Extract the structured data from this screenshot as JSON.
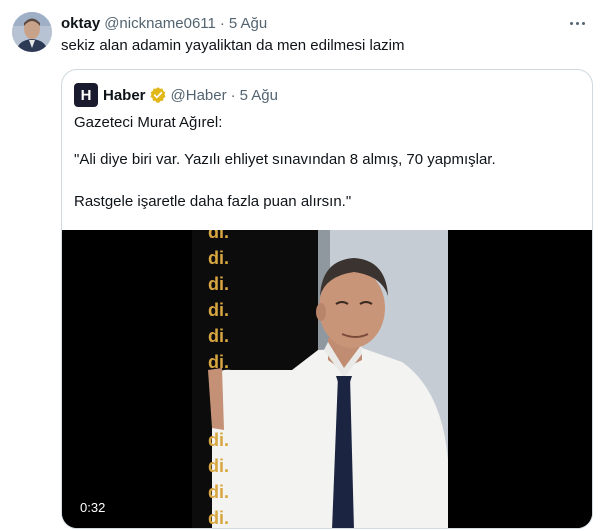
{
  "post": {
    "name": "oktay",
    "handle": "@nickname0611",
    "separator": "·",
    "date": "5 Ağu",
    "text": "sekiz alan adamin yayaliktan da men edilmesi lazim"
  },
  "quote": {
    "avatar_letter": "H",
    "name": "Haber",
    "handle": "@Haber",
    "separator": "·",
    "date": "5 Ağu",
    "line1": "Gazeteci Murat Ağırel:",
    "line2": "\"Ali diye biri var. Yazılı ehliyet sınavından 8 almış, 70 yapmışlar.",
    "line3": "Rastgele işaretle daha fazla puan alırsın.\"",
    "video": {
      "duration": "0:32",
      "backdrop_text": "di."
    }
  },
  "colors": {
    "text_primary": "#0f1419",
    "text_secondary": "#536471",
    "border": "#cfd9de",
    "verified_gold": "#e2b719",
    "backdrop_gold": "#d8a640"
  },
  "icons": {
    "more": "more-horizontal-icon",
    "verified": "verified-badge-icon"
  }
}
